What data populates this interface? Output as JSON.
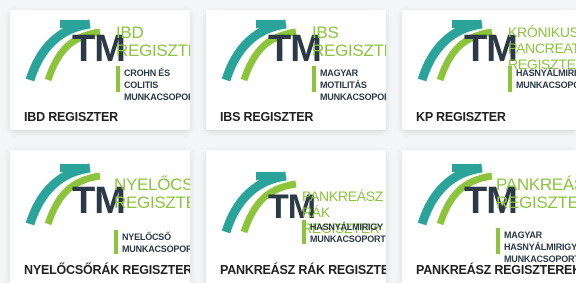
{
  "cards": [
    {
      "logo_title": "IBD\nREGISZTER",
      "logo_sub": "CROHN ÉS COLITIS\nMUNKACSOPORT",
      "logo_tm": "TM",
      "title": "IBD REGISZTER"
    },
    {
      "logo_title": "IBS\nREGISZTER",
      "logo_sub": "MAGYAR MOTILITÁS\nMUNKACSOPORT",
      "logo_tm": "TM",
      "title": "IBS REGISZTER"
    },
    {
      "logo_title": "KRÓNIKUS PANCREATITIS\nREGISZTER",
      "logo_sub": "HASNYÁLMIRIGY\nMUNKACSOPORT",
      "logo_tm": "TM",
      "title": "KP REGISZTER"
    },
    {
      "logo_title": "NYELŐCSŐRÁK\nREGISZTER",
      "logo_sub": "NYELŐCSŐ\nMUNKACSOPORT",
      "logo_tm": "TM",
      "title": "NYELŐCSŐRÁK REGISZTER"
    },
    {
      "logo_title": "PANKREÁSZ RÁK\nREGISZTER",
      "logo_sub": "HASNYÁLMIRIGY\nMUNKACSOPORT",
      "logo_tm": "TM",
      "title": "PANKREÁSZ RÁK REGISZTER"
    },
    {
      "logo_title": "PANKREÁSZ\nREGISZTEREK",
      "logo_sub": "MAGYAR HASNYÁLMIRIGY\nMUNKACSOPORT",
      "logo_tm": "TM",
      "title": "PANKREÁSZ REGISZTEREK"
    }
  ],
  "colors": {
    "brand_green": "#8cc43c",
    "brand_teal": "#2aa39a",
    "brand_dark": "#2b3a46"
  }
}
